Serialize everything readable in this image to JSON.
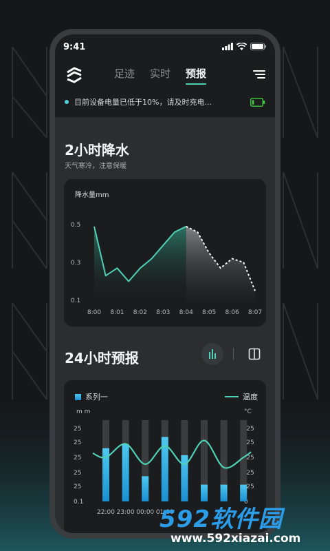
{
  "status": {
    "time": "9:41"
  },
  "nav": {
    "tabs": [
      {
        "label": "足迹",
        "active": false
      },
      {
        "label": "实时",
        "active": false
      },
      {
        "label": "预报",
        "active": true
      }
    ]
  },
  "notice": {
    "text": "目前设备电量已低于10%，请及时充电..."
  },
  "section1": {
    "title": "2小时降水",
    "subtitle": "天气寒冷，注意保暖"
  },
  "section2": {
    "title": "24小时预报"
  },
  "colors": {
    "accent": "#4fd1b6",
    "bar": "#29b6f6",
    "battery": "#3ecf3e"
  },
  "chart_data": [
    {
      "type": "line",
      "title": "降水量mm",
      "x": [
        "8:00",
        "8:01",
        "8:02",
        "8:03",
        "8:04",
        "8:05",
        "8:06",
        "8:07"
      ],
      "yticks": [
        "0.5",
        "0.3",
        "0.1"
      ],
      "ylim": [
        0.1,
        0.5
      ],
      "points": [
        [
          0,
          0.49
        ],
        [
          0.5,
          0.23
        ],
        [
          1,
          0.27
        ],
        [
          1.5,
          0.2
        ],
        [
          2,
          0.27
        ],
        [
          2.5,
          0.32
        ],
        [
          3,
          0.39
        ],
        [
          3.5,
          0.46
        ],
        [
          4,
          0.49
        ],
        [
          4.5,
          0.46
        ],
        [
          5,
          0.35
        ],
        [
          5.5,
          0.27
        ],
        [
          6,
          0.32
        ],
        [
          6.5,
          0.3
        ],
        [
          7,
          0.15
        ]
      ],
      "forecast_from_index": 8,
      "grid": false,
      "legend": "none"
    },
    {
      "type": "bar",
      "legend": [
        "系列一",
        "温度"
      ],
      "left_unit": "m m",
      "right_unit": "°C",
      "yticks_left": [
        "25",
        "25",
        "25",
        "25",
        "25",
        "0.1"
      ],
      "yticks_right": [
        "-25",
        "-25",
        "-25",
        "-25",
        "-25",
        "0"
      ],
      "categories": [
        "22:00",
        "23:00",
        "00:00",
        "01:00",
        "",
        "",
        "",
        ""
      ],
      "series": [
        {
          "name": "系列一",
          "values": [
            19,
            20.5,
            9,
            23,
            16.5,
            6,
            6,
            6
          ]
        },
        {
          "name": "温度",
          "values": [
            -20.5,
            -18.5,
            -21.5,
            -18.8,
            -21.5,
            -18,
            -22,
            -20.5
          ]
        }
      ],
      "bar_ylim": [
        0,
        29
      ],
      "line_ylim": [
        -27,
        -15
      ],
      "grid": false,
      "legend_position": "top"
    }
  ],
  "watermark": {
    "main": "592软件园",
    "url": "www.592xiazai.com"
  }
}
